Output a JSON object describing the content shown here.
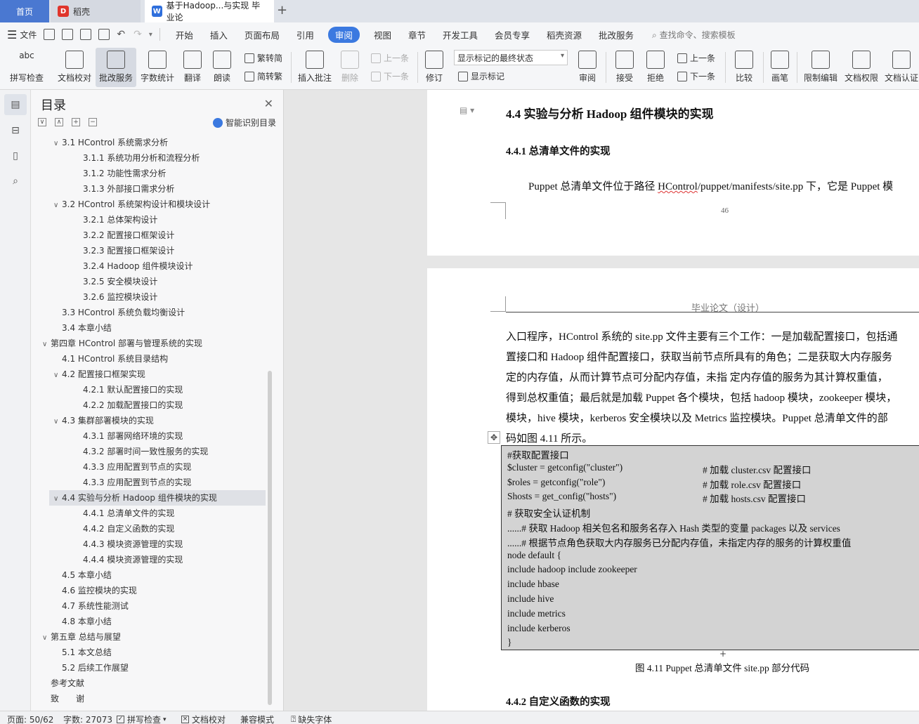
{
  "tabs": {
    "home": "首页",
    "docer": "稻壳",
    "document": "基于Hadoop...与实现 毕业论",
    "add": "+"
  },
  "menu": {
    "file": "文件",
    "items": [
      "开始",
      "插入",
      "页面布局",
      "引用",
      "审阅",
      "视图",
      "章节",
      "开发工具",
      "会员专享",
      "稻壳资源",
      "批改服务"
    ],
    "active": "审阅",
    "search": "查找命令、搜索模板"
  },
  "ribbon": {
    "spellcheck": "拼写检查",
    "doc_proof": "文档校对",
    "revise_service": "批改服务",
    "word_count": "字数统计",
    "translate": "翻译",
    "read_aloud": "朗读",
    "trad_to_simp": "繁转简",
    "simp_to_trad": "简转繁",
    "insert_comment": "插入批注",
    "delete": "删除",
    "prev": "上一条",
    "next": "下一条",
    "track_changes": "修订",
    "markup_mode": "显示标记的最终状态",
    "show_markup": "显示标记",
    "review": "审阅",
    "accept": "接受",
    "reject": "拒绝",
    "prev2": "上一条",
    "next2": "下一条",
    "compare": "比较",
    "pen": "画笔",
    "restrict_edit": "限制编辑",
    "doc_permission": "文档权限",
    "doc_certify": "文档认证"
  },
  "toc": {
    "title": "目录",
    "ai_label": "智能识别目录",
    "items": [
      {
        "text": "3.1  HControl 系统需求分析",
        "level": 2,
        "arrow": "∨"
      },
      {
        "text": "3.1.1  系统功用分析和流程分析",
        "level": 3,
        "arrow": ""
      },
      {
        "text": "3.1.2  功能性需求分析",
        "level": 3,
        "arrow": ""
      },
      {
        "text": "3.1.3  外部接口需求分析",
        "level": 3,
        "arrow": ""
      },
      {
        "text": "3.2  HControl 系统架构设计和模块设计",
        "level": 2,
        "arrow": "∨"
      },
      {
        "text": "3.2.1  总体架构设计",
        "level": 3,
        "arrow": ""
      },
      {
        "text": "3.2.2  配置接口框架设计",
        "level": 3,
        "arrow": ""
      },
      {
        "text": "3.2.3  配置接口框架设计",
        "level": 3,
        "arrow": ""
      },
      {
        "text": "3.2.4 Hadoop 组件模块设计",
        "level": 3,
        "arrow": ""
      },
      {
        "text": "3.2.5  安全模块设计",
        "level": 3,
        "arrow": ""
      },
      {
        "text": "3.2.6  监控模块设计",
        "level": 3,
        "arrow": ""
      },
      {
        "text": "3.3  HControl 系统负载均衡设计",
        "level": 2,
        "arrow": ""
      },
      {
        "text": "3.4  本章小结",
        "level": 2,
        "arrow": ""
      },
      {
        "text": "第四章  HControl 部署与管理系统的实现",
        "level": 1,
        "arrow": "∨"
      },
      {
        "text": "4.1  HControl 系统目录结构",
        "level": 2,
        "arrow": ""
      },
      {
        "text": "4.2  配置接口框架实现",
        "level": 2,
        "arrow": "∨"
      },
      {
        "text": "4.2.1  默认配置接口的实现",
        "level": 3,
        "arrow": ""
      },
      {
        "text": "4.2.2  加载配置接口的实现",
        "level": 3,
        "arrow": ""
      },
      {
        "text": "4.3  集群部署模块的实现",
        "level": 2,
        "arrow": "∨"
      },
      {
        "text": "4.3.1  部署网络环境的实现",
        "level": 3,
        "arrow": ""
      },
      {
        "text": "4.3.2  部署时间一致性服务的实现",
        "level": 3,
        "arrow": ""
      },
      {
        "text": "4.3.3  应用配置到节点的实现",
        "level": 3,
        "arrow": ""
      },
      {
        "text": "4.3.3  应用配置到节点的实现",
        "level": 3,
        "arrow": ""
      },
      {
        "text": "4.4  实验与分析 Hadoop 组件模块的实现",
        "level": 2,
        "arrow": "∨",
        "selected": true
      },
      {
        "text": "4.4.1  总清单文件的实现",
        "level": 3,
        "arrow": ""
      },
      {
        "text": "4.4.2  自定义函数的实现",
        "level": 3,
        "arrow": ""
      },
      {
        "text": "4.4.3  模块资源管理的实现",
        "level": 3,
        "arrow": ""
      },
      {
        "text": "4.4.4  模块资源管理的实现",
        "level": 3,
        "arrow": ""
      },
      {
        "text": "4.5  本章小结",
        "level": 2,
        "arrow": ""
      },
      {
        "text": "4.6  监控模块的实现",
        "level": 2,
        "arrow": ""
      },
      {
        "text": "4.7  系统性能测试",
        "level": 2,
        "arrow": ""
      },
      {
        "text": "4.8  本章小结",
        "level": 2,
        "arrow": ""
      },
      {
        "text": "第五章  总结与展望",
        "level": 1,
        "arrow": "∨"
      },
      {
        "text": "5.1  本文总结",
        "level": 2,
        "arrow": ""
      },
      {
        "text": "5.2  后续工作展望",
        "level": 2,
        "arrow": ""
      },
      {
        "text": "参考文献",
        "level": 1,
        "arrow": ""
      },
      {
        "text": "致　　谢",
        "level": 1,
        "arrow": ""
      }
    ]
  },
  "document": {
    "page1": {
      "heading": "4.4  实验与分析 Hadoop 组件模块的实现",
      "subheading": "4.4.1 总清单文件的实现",
      "para_a": "Puppet 总清单文件位于路径 ",
      "para_path": "HControl",
      "para_b": "/puppet/manifests/site.pp 下，它是  Puppet 模",
      "page_number": "46"
    },
    "page2": {
      "header": "毕业论文（设计）",
      "lines": [
        "入口程序，HControl 系统的 site.pp 文件主要有三个工作：一是加载配置接口，包括通",
        "置接口和 Hadoop 组件配置接口，获取当前节点所具有的角色；二是获取大内存服务",
        "定的内存值，从而计算节点可分配内存值，未指  定内存值的服务为其计算权重值，",
        "得到总权重值；最后就是加载 Puppet 各个模块，包括 hadoop 模块，zookeeper 模块，",
        "模块，hive 模块，kerberos  安全模块以及 Metrics 监控模块。Puppet 总清单文件的部",
        "码如图 4.11 所示。"
      ],
      "code": [
        {
          "code": "#获取配置接口",
          "comment": ""
        },
        {
          "code": "$cluster = getconfig(\"cluster\")",
          "comment": "#  加载 cluster.csv 配置接口"
        },
        {
          "code": "$roles = getconfig(\"role\")",
          "comment": "#  加载 role.csv 配置接口"
        },
        {
          "code": "Shosts = get_config(\"hosts\")",
          "comment": "#  加载 hosts.csv 配置接口"
        },
        {
          "code": "#  获取安全认证机制",
          "comment": ""
        },
        {
          "code": "......#  获取 Hadoop 相关包名和服务名存入 Hash 类型的变量 packages 以及  services",
          "comment": ""
        },
        {
          "code": "......#  根据节点角色获取大内存服务已分配内存值，未指定内存的服务的计算权重值",
          "comment": ""
        },
        {
          "code": "node default {",
          "comment": ""
        },
        {
          "code": "        include hadoop include zookeeper",
          "comment": ""
        },
        {
          "code": "        include hbase",
          "comment": ""
        },
        {
          "code": "        include hive",
          "comment": ""
        },
        {
          "code": "        include metrics",
          "comment": ""
        },
        {
          "code": "        include kerberos",
          "comment": ""
        },
        {
          "code": "}",
          "comment": ""
        }
      ],
      "caption": "图 4.11 Puppet 总清单文件 site.pp 部分代码",
      "next_heading": "4.4.2 自定义函数的实现"
    }
  },
  "status": {
    "page": "页面: 50/62",
    "words": "字数: 27073",
    "spellcheck": "拼写检查",
    "proof": "文档校对",
    "compat": "兼容模式",
    "missing_font": "缺失字体"
  }
}
